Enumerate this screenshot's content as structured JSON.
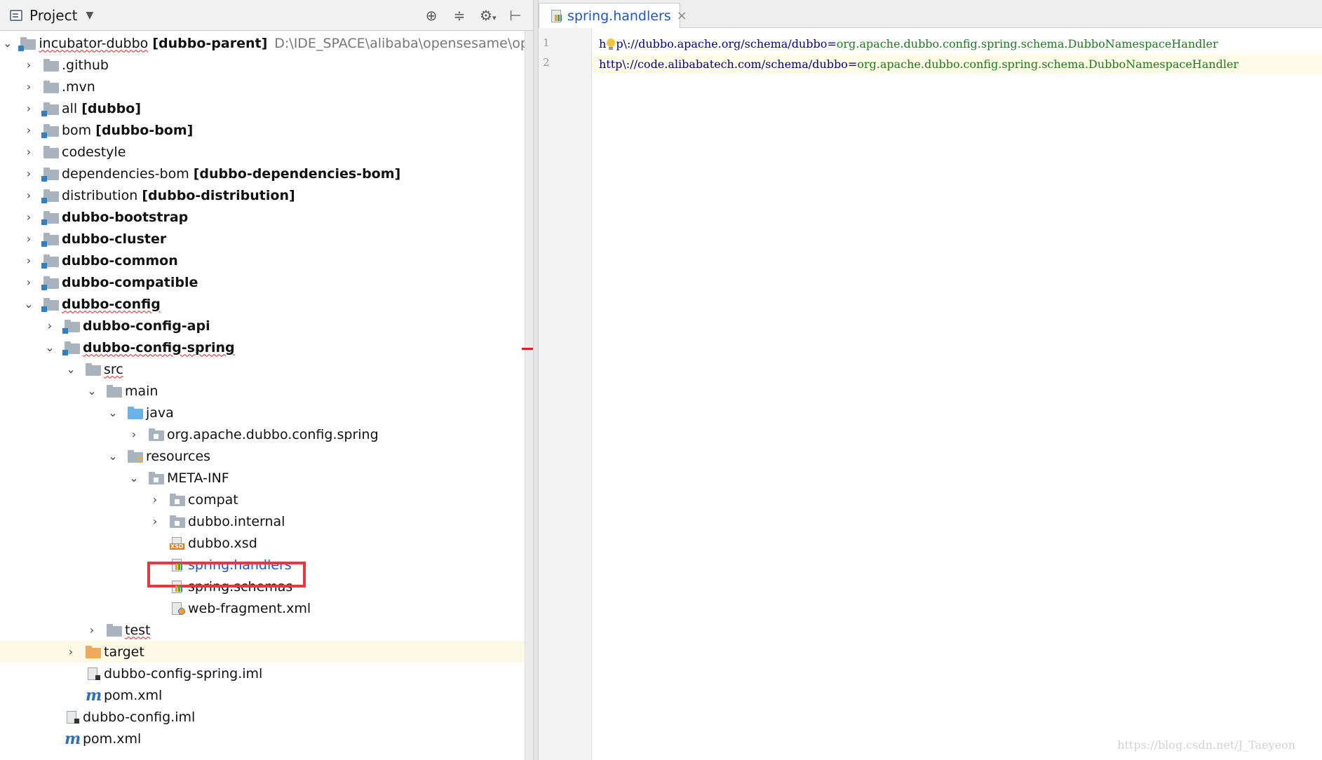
{
  "project_panel": {
    "title": "Project",
    "tools": [
      "locate-icon",
      "collapse-icon",
      "gear-icon",
      "hide-icon"
    ],
    "tree": [
      {
        "label": "incubator-dubbo",
        "suffix": "[dubbo-parent]",
        "path": "D:\\IDE_SPACE\\alibaba\\opensesame\\opensesam"
      },
      {
        "label": ".github"
      },
      {
        "label": ".mvn"
      },
      {
        "label": "all",
        "suffix": "[dubbo]"
      },
      {
        "label": "bom",
        "suffix": "[dubbo-bom]"
      },
      {
        "label": "codestyle"
      },
      {
        "label": "dependencies-bom",
        "suffix": "[dubbo-dependencies-bom]"
      },
      {
        "label": "distribution",
        "suffix": "[dubbo-distribution]"
      },
      {
        "label": "dubbo-bootstrap"
      },
      {
        "label": "dubbo-cluster"
      },
      {
        "label": "dubbo-common"
      },
      {
        "label": "dubbo-compatible"
      },
      {
        "label": "dubbo-config"
      },
      {
        "label": "dubbo-config-api"
      },
      {
        "label": "dubbo-config-spring"
      },
      {
        "label": "src"
      },
      {
        "label": "main"
      },
      {
        "label": "java"
      },
      {
        "label": "org.apache.dubbo.config.spring"
      },
      {
        "label": "resources"
      },
      {
        "label": "META-INF"
      },
      {
        "label": "compat"
      },
      {
        "label": "dubbo.internal"
      },
      {
        "label": "dubbo.xsd"
      },
      {
        "label": "spring.handlers"
      },
      {
        "label": "spring.schemas"
      },
      {
        "label": "web-fragment.xml"
      },
      {
        "label": "test"
      },
      {
        "label": "target"
      },
      {
        "label": "dubbo-config-spring.iml"
      },
      {
        "label": "pom.xml"
      },
      {
        "label": "dubbo-config.iml"
      },
      {
        "label": "pom.xml"
      }
    ]
  },
  "editor": {
    "tab": {
      "label": "spring.handlers",
      "close": "×"
    },
    "lines": [
      {
        "number": "1",
        "key_pre": "h",
        "key_post": "p\\://dubbo.apache.org/schema/dubbo",
        "eq": "=",
        "value": "org.apache.dubbo.config.spring.schema.DubboNamespaceHandler"
      },
      {
        "number": "2",
        "key_pre": "http\\://code.alibabatech.com/schema/dubbo",
        "key_post": "",
        "eq": "=",
        "value": "org.apache.dubbo.config.spring.schema.DubboNamespaceHandler"
      }
    ]
  },
  "watermark": "https://blog.csdn.net/J_Taeyeon",
  "colors": {
    "highlight_box": "#e8383d",
    "link": "#1d55c9",
    "key": "#000080",
    "value": "#1c7a1c"
  }
}
